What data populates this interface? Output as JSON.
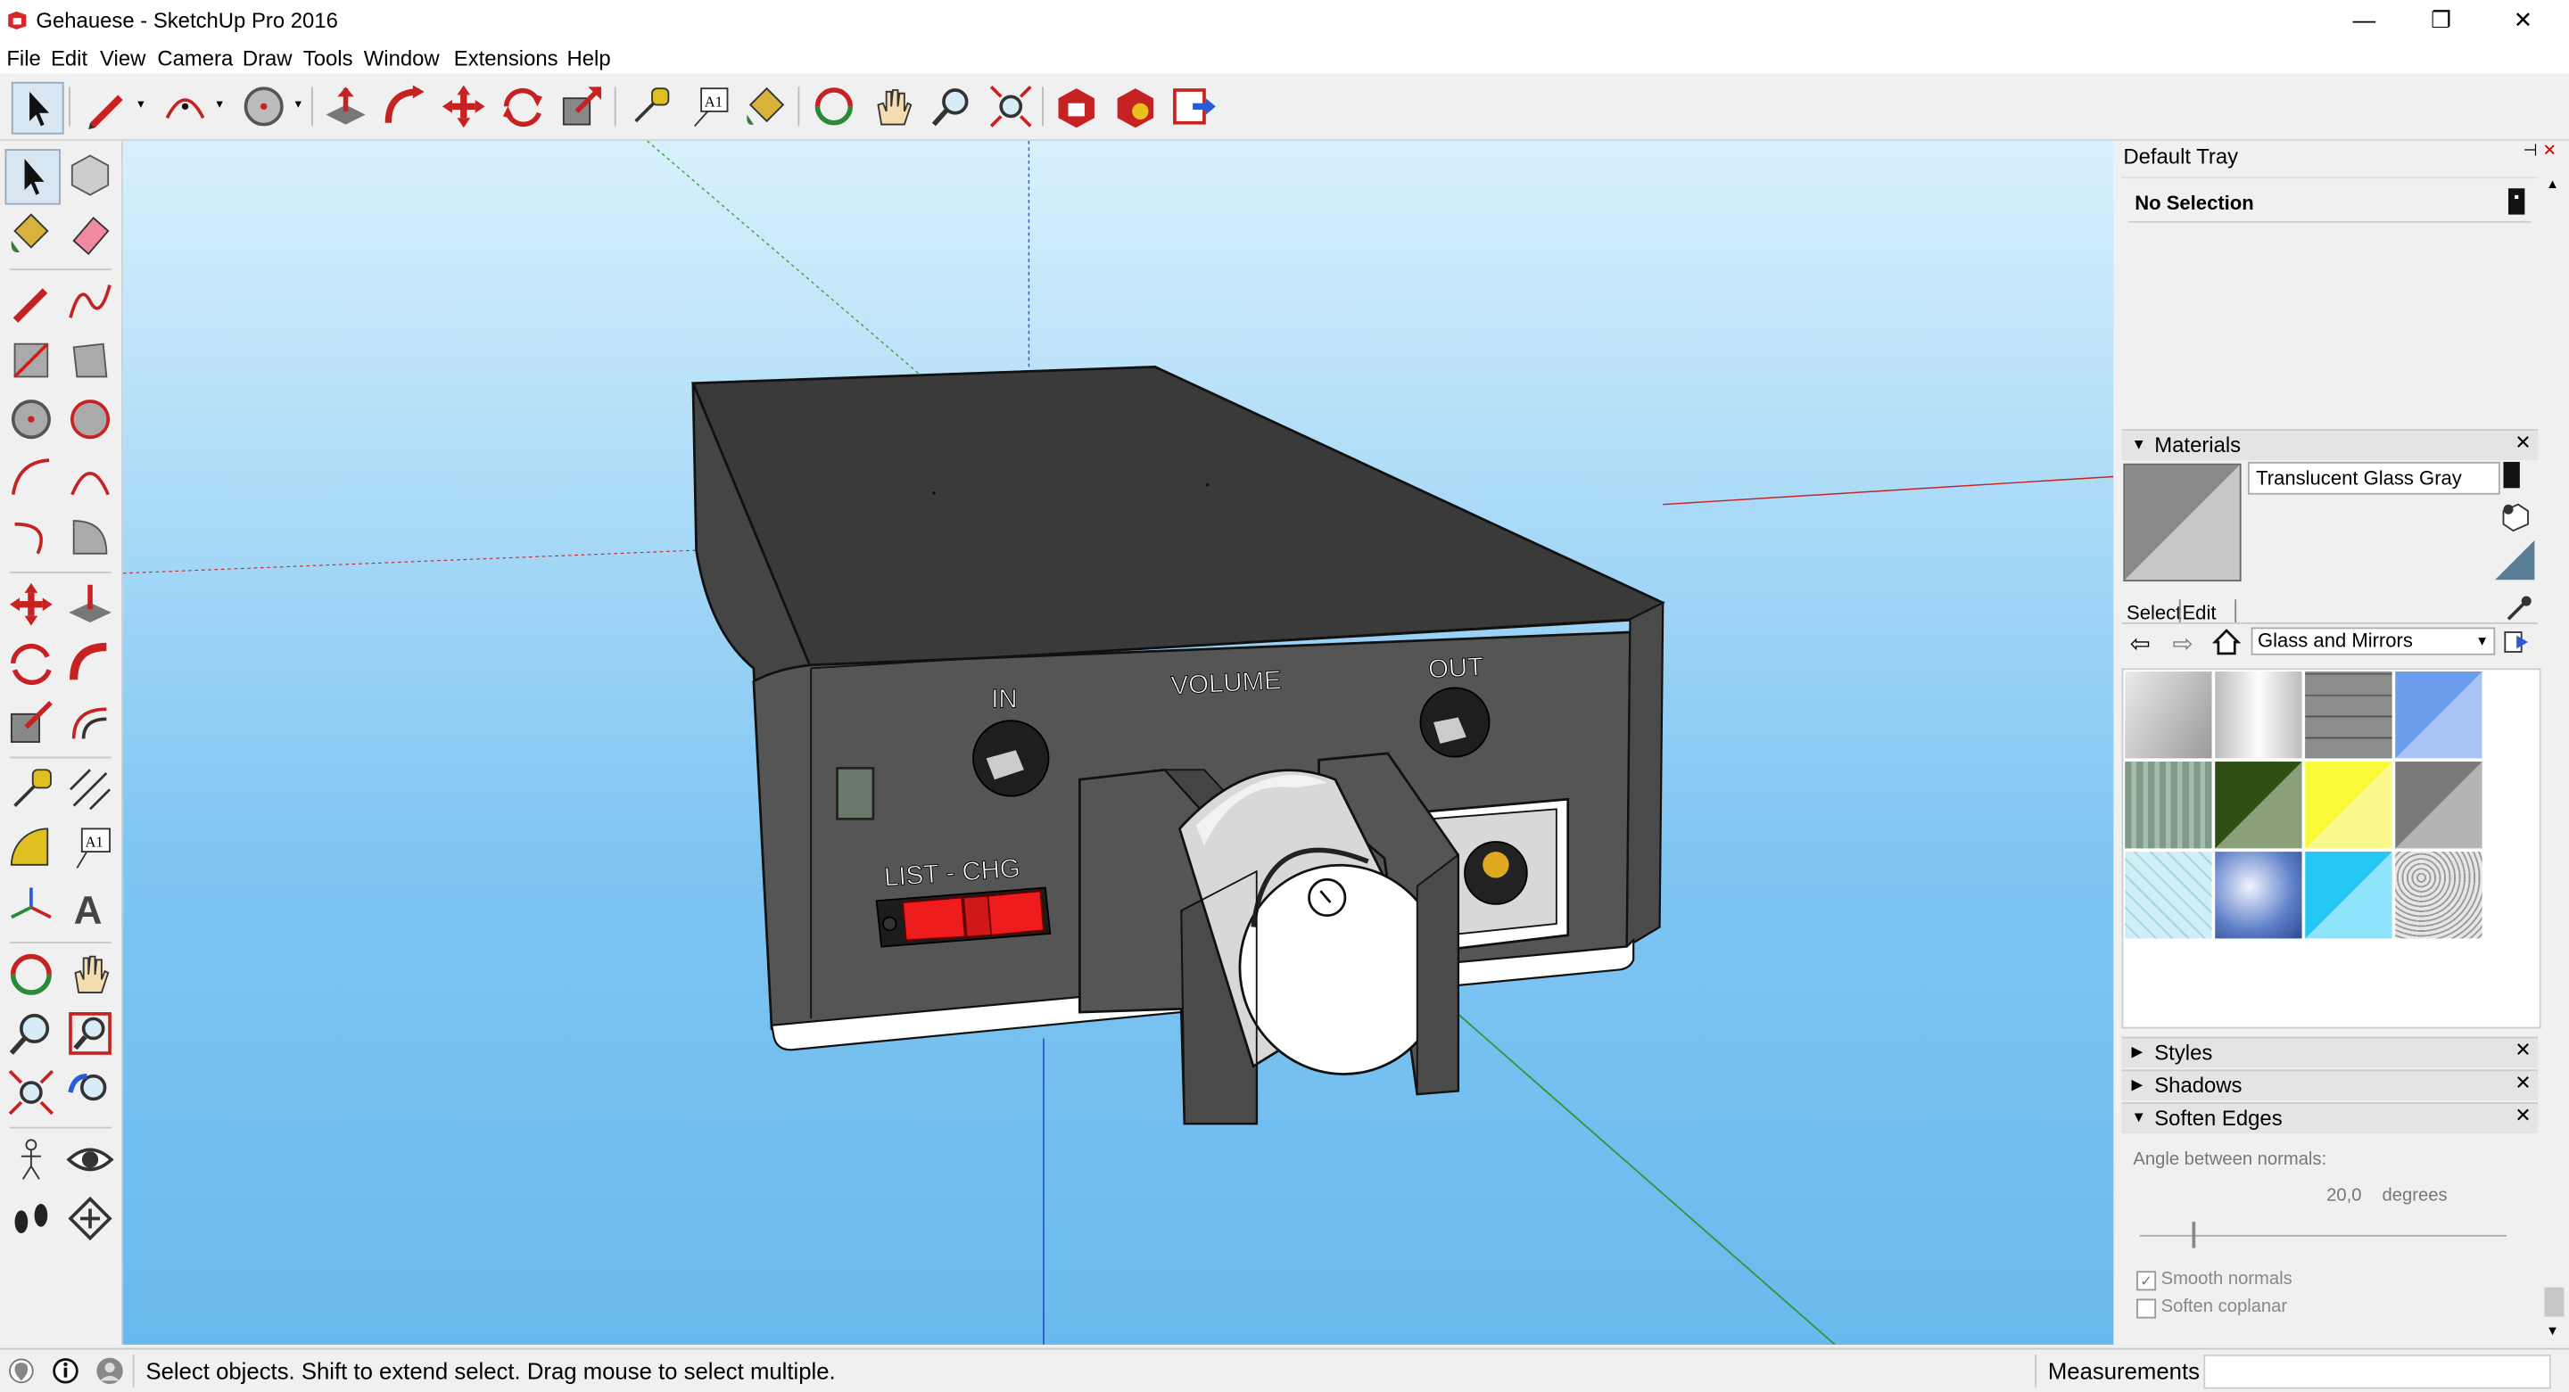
{
  "window": {
    "title": "Gehauese - SketchUp Pro 2016",
    "minimize": "—",
    "restore": "❐",
    "close": "✕"
  },
  "menu": [
    "File",
    "Edit",
    "View",
    "Camera",
    "Draw",
    "Tools",
    "Window",
    "Extensions",
    "Help"
  ],
  "model": {
    "label_in": "IN",
    "label_volume": "VOLUME",
    "label_out": "OUT",
    "label_list": "LIST - CHG"
  },
  "tray": {
    "title": "Default Tray",
    "entity_info": "No Selection",
    "materials": {
      "header": "Materials",
      "current_name": "Translucent Glass Gray",
      "tab_select": "Select",
      "tab_edit": "Edit",
      "collection": "Glass and Mirrors",
      "swatches": [
        "#c8c8c8",
        "#e6e6e6",
        "#8c8c8c",
        "#6c9cec",
        "#7f9a86",
        "#2e4f11",
        "#fafa3a",
        "#9a9a9a",
        "#cfeef6",
        "#5d7fc8",
        "#22c8f2",
        "#cfcfcf"
      ]
    },
    "styles": "Styles",
    "shadows": "Shadows",
    "soften": {
      "header": "Soften Edges",
      "angle_label": "Angle between normals:",
      "angle_value": "20,0",
      "angle_unit": "degrees",
      "smooth": "Smooth normals",
      "coplanar": "Soften coplanar"
    }
  },
  "status": {
    "message": "Select objects. Shift to extend select. Drag mouse to select multiple.",
    "measurements_label": "Measurements"
  },
  "colors": {
    "box_top": "#3a3a3a",
    "box_side": "#454545",
    "box_front": "#555555",
    "switch_red": "#ee1c1c",
    "sky_top": "#d8f0fc",
    "sky_bottom": "#6ab9ee"
  }
}
